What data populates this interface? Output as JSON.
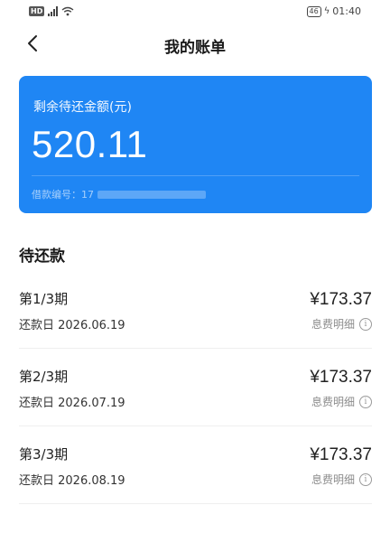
{
  "status_bar": {
    "hd": "HD",
    "network": "4G",
    "battery": "46",
    "time": "01:40"
  },
  "nav": {
    "title": "我的账单",
    "back_icon": "chevron-left-icon"
  },
  "card": {
    "label": "剩余待还金额(元)",
    "amount": "520.11",
    "loan_label": "借款编号：",
    "loan_prefix": "17",
    "color": "#1f86f4"
  },
  "section": {
    "title": "待还款"
  },
  "installments": [
    {
      "period": "第1/3期",
      "date": "还款日 2026.06.19",
      "amount": "¥173.37",
      "detail": "息费明细"
    },
    {
      "period": "第2/3期",
      "date": "还款日 2026.07.19",
      "amount": "¥173.37",
      "detail": "息费明细"
    },
    {
      "period": "第3/3期",
      "date": "还款日 2026.08.19",
      "amount": "¥173.37",
      "detail": "息费明细"
    }
  ]
}
